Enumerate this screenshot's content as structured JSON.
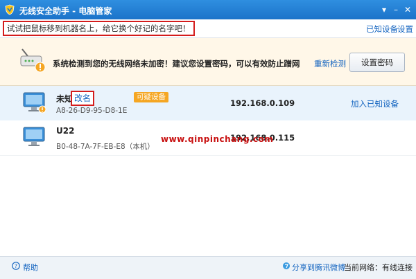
{
  "window": {
    "title": "无线安全助手 - 电脑管家"
  },
  "toolbar": {
    "hint": "试试把鼠标移到机器名上，给它换个好记的名字吧！",
    "known_devices": "已知设备",
    "settings": "设置"
  },
  "banner": {
    "message": "系统检测到您的无线网络未加密！建议您设置密码，可以有效防止蹭网",
    "recheck": "重新检测",
    "set_password": "设置密码"
  },
  "devices": [
    {
      "name": "未知",
      "rename": "改名",
      "mac": "A8-26-D9-95-D8-1E",
      "badge": "可疑设备",
      "ip": "192.168.0.109",
      "action": "加入已知设备"
    },
    {
      "name": "U22",
      "mac": "B0-48-7A-7F-EB-E8（本机）",
      "ip": "192.168.0.115"
    }
  ],
  "watermark": "www.qinpinchang.com",
  "footer": {
    "help": "帮助",
    "share": "分享到腾讯微博",
    "network_status": "当前网络：有线连接"
  },
  "colors": {
    "titlebar": "#1f7ad0",
    "warning_badge": "#f5a623",
    "link": "#1565c0",
    "highlight_box": "#d41c1c"
  }
}
